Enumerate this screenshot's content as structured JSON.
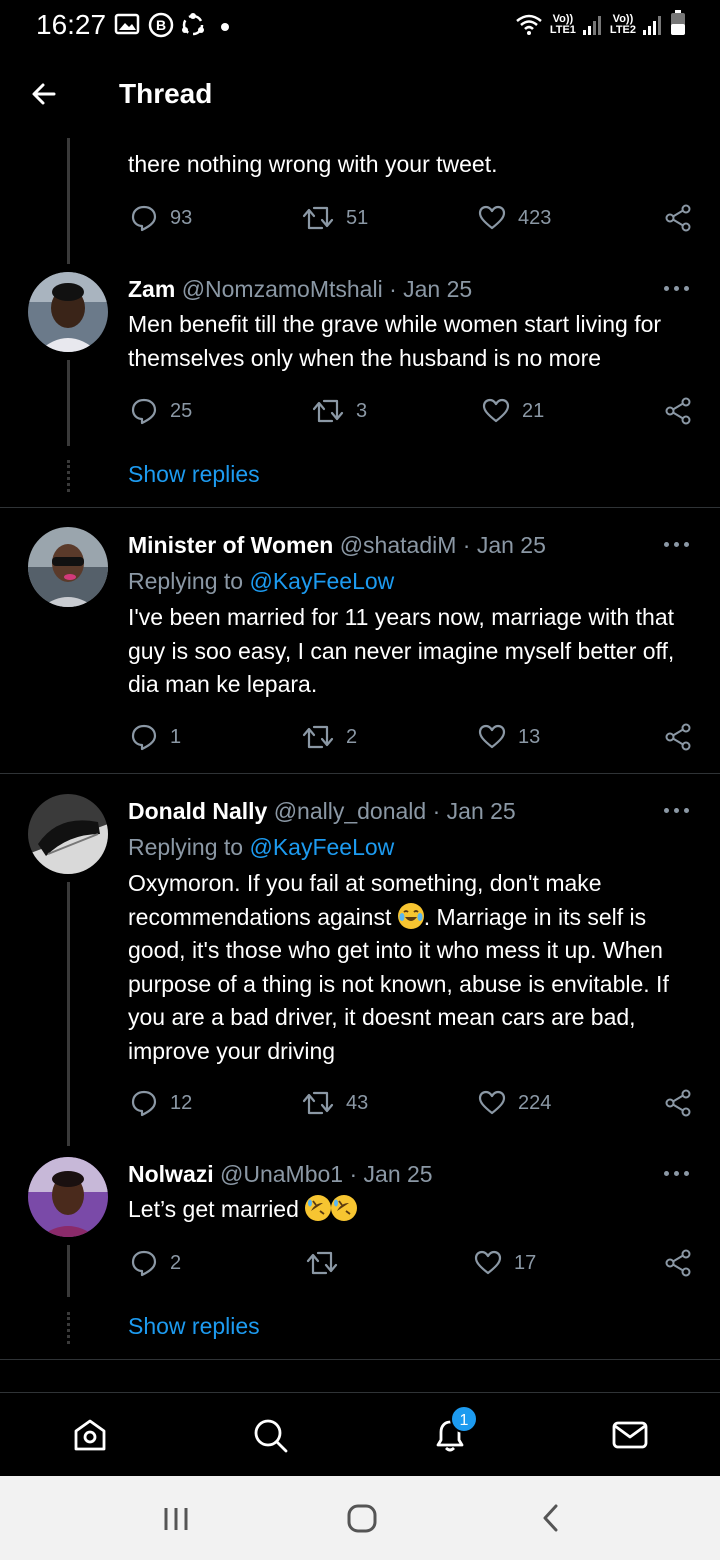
{
  "status_bar": {
    "time": "16:27",
    "sim1": "LTE1",
    "sim2": "LTE2",
    "volte": "Vo))"
  },
  "header": {
    "title": "Thread"
  },
  "partial_tweet": {
    "text": "there nothing wrong with your tweet.",
    "replies": "93",
    "retweets": "51",
    "likes": "423"
  },
  "tweets": [
    {
      "name": "Zam",
      "handle": "@NomzamoMtshali",
      "date": "· Jan 25",
      "text": "Men benefit till the grave while women start living for themselves only when the husband is no more",
      "replies": "25",
      "retweets": "3",
      "likes": "21",
      "show_replies": "Show replies"
    },
    {
      "name": "Minister of Women",
      "handle": "@shatadiM",
      "date": "· Jan 25",
      "replying_prefix": "Replying to",
      "replying_to": "@KayFeeLow",
      "text": "I've been married for 11 years now, marriage with that guy is soo easy, I can never imagine myself better off, dia man ke lepara.",
      "replies": "1",
      "retweets": "2",
      "likes": "13"
    },
    {
      "name": "Donald Nally",
      "handle": "@nally_donald",
      "date": "· Jan 25",
      "replying_prefix": "Replying to",
      "replying_to": "@KayFeeLow",
      "text_a": "Oxymoron. If you fail at something, don't make recommendations against ",
      "text_b": ". Marriage in its self is good, it's those who get into it who mess it up. When purpose of a thing is not known, abuse is envitable. If you are a bad driver, it doesnt mean cars are bad, improve your driving",
      "replies": "12",
      "retweets": "43",
      "likes": "224"
    },
    {
      "name": "Nolwazi",
      "handle": "@UnaMbo1",
      "date": "· Jan 25",
      "text": "Let’s get married",
      "replies": "2",
      "retweets": "",
      "likes": "17",
      "show_replies": "Show replies"
    }
  ],
  "bottom_nav": {
    "notification_count": "1"
  },
  "colors": {
    "accent": "#1d9bf0",
    "muted": "#8b98a5",
    "background": "#000000"
  }
}
